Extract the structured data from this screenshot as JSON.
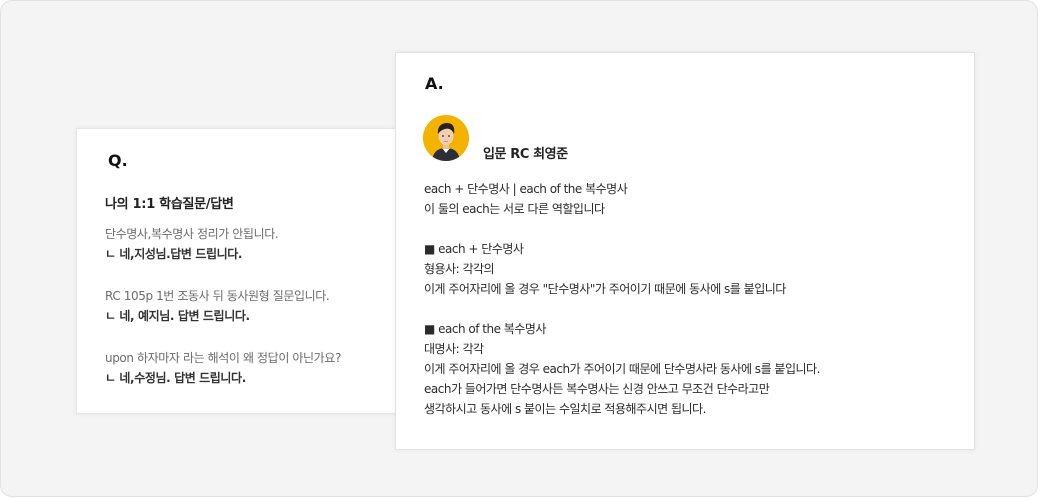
{
  "question_card": {
    "marker": "Q.",
    "title": "나의 1:1 학습질문/답변",
    "items": [
      {
        "question": "단수명사,복수명사 정리가 안됩니다.",
        "reply": "ㄴ 네,지성님.답변 드립니다."
      },
      {
        "question": "RC 105p 1번 조동사 뒤 동사원형 질문입니다.",
        "reply": "ㄴ 네, 예지님. 답변 드립니다."
      },
      {
        "question": "upon 하자마자 라는 해석이 왜 정답이 아닌가요?",
        "reply": "ㄴ 네,수정님. 답변 드립니다."
      }
    ]
  },
  "answer_card": {
    "marker": "A.",
    "avatar_icon": "teacher-portrait",
    "teacher_name": "입문 RC 최영준",
    "lines": [
      "each + 단수명사 | each of the 복수명사",
      "이 둘의 each는 서로 다른 역할입니다",
      "",
      "■ each + 단수명사",
      "형용사: 각각의",
      "이게 주어자리에 올 경우 \"단수명사\"가 주어이기 때문에 동사에 s를 붙입니다",
      "",
      "■ each of the 복수명사",
      "대명사: 각각",
      "이게 주어자리에 올 경우 each가 주어이기 때문에 단수명사라 동사에 s를 붙입니다.",
      "each가 들어가면 단수명사든 복수명사는 신경 안쓰고 무조건 단수라고만",
      "생각하시고 동사에 s 붙이는 수일치로 적용해주시면 됩니다."
    ]
  },
  "colors": {
    "background": "#f4f4f4",
    "card": "#ffffff",
    "avatar_bg": "#f4b300"
  }
}
